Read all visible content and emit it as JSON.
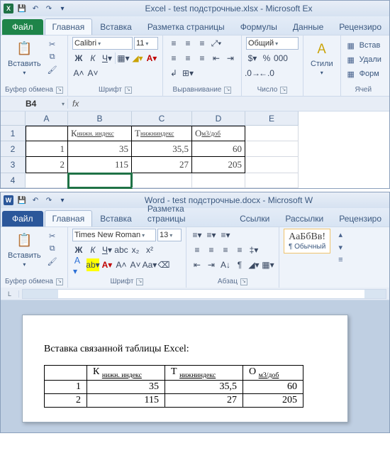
{
  "excel": {
    "title": "Excel - test подстрочные.xlsx  -  Microsoft Ex",
    "tabs": {
      "file": "Файл",
      "home": "Главная",
      "insert": "Вставка",
      "layout": "Разметка страницы",
      "formulas": "Формулы",
      "data": "Данные",
      "review": "Рецензиро"
    },
    "groups": {
      "clipboard": "Буфер обмена",
      "font": "Шрифт",
      "align": "Выравнивание",
      "number": "Число",
      "styles": "",
      "cells": "Ячей"
    },
    "clipboard": {
      "paste": "Вставить"
    },
    "font": {
      "name": "Calibri",
      "size": "11"
    },
    "number": {
      "category": "Общий"
    },
    "styles": {
      "label": "Стили"
    },
    "cells": {
      "insert": "Встав",
      "delete": "Удали",
      "format": "Форм"
    },
    "namebox": "B4",
    "headers": [
      "A",
      "B",
      "C",
      "D",
      "E"
    ],
    "rows": [
      {
        "n": "1",
        "A": "",
        "B": "К нижн. индекс",
        "C": "Т нижниндекс",
        "D": "О м3/доб",
        "E": ""
      },
      {
        "n": "2",
        "A": "1",
        "B": "35",
        "C": "35,5",
        "D": "60",
        "E": ""
      },
      {
        "n": "3",
        "A": "2",
        "B": "115",
        "C": "27",
        "D": "205",
        "E": ""
      },
      {
        "n": "4",
        "A": "",
        "B": "",
        "C": "",
        "D": "",
        "E": ""
      }
    ]
  },
  "word": {
    "title": "Word  -  test подстрочные.docx  -  Microsoft W",
    "tabs": {
      "file": "Файл",
      "home": "Главная",
      "insert": "Вставка",
      "layout": "Разметка страницы",
      "refs": "Ссылки",
      "mail": "Рассылки",
      "review": "Рецензиро"
    },
    "groups": {
      "clipboard": "Буфер обмена",
      "font": "Шрифт",
      "paragraph": "Абзац"
    },
    "clipboard": {
      "paste": "Вставить"
    },
    "font": {
      "name": "Times New Roman",
      "size": "13"
    },
    "styles": {
      "sample": "АаБбВв!",
      "normal": "¶ Обычный"
    },
    "doc": {
      "text": "Вставка связанной таблицы Excel:",
      "table": {
        "headers": [
          "",
          "К нижн. индекс",
          "Т нижниндекс",
          "О м3/доб"
        ],
        "rows": [
          [
            "1",
            "35",
            "35,5",
            "60"
          ],
          [
            "2",
            "115",
            "27",
            "205"
          ]
        ]
      }
    }
  }
}
